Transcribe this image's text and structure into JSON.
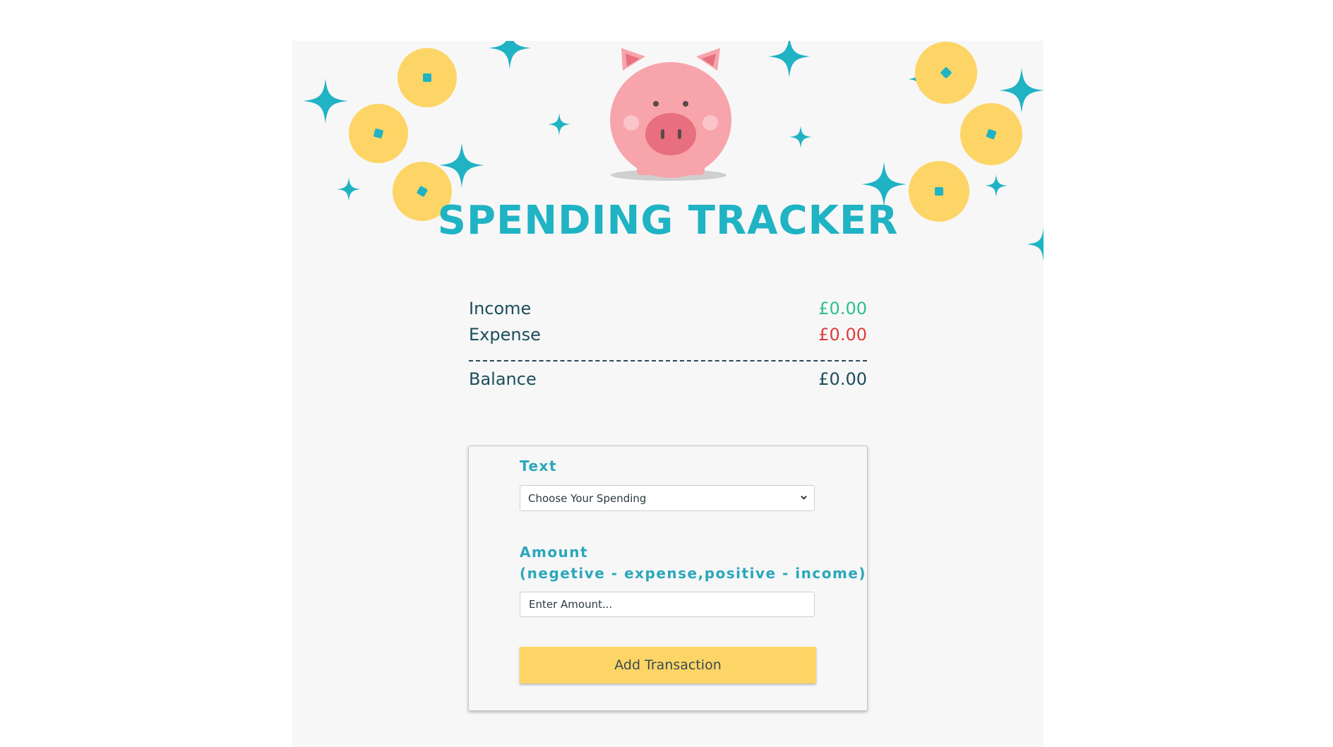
{
  "header": {
    "title": "SPENDING TRACKER",
    "illustration": "piggy-bank-with-coins-and-sparkles"
  },
  "summary": {
    "income": {
      "label": "Income",
      "value": "£0.00"
    },
    "expense": {
      "label": "Expense",
      "value": "£0.00"
    },
    "balance": {
      "label": "Balance",
      "value": "£0.00"
    }
  },
  "form": {
    "text_label": "Text",
    "select_value": "Choose Your Spending",
    "amount_label": "Amount",
    "amount_hint": "(negetive - expense,positive - income)",
    "amount_placeholder": "Enter Amount...",
    "submit_label": "Add Transaction"
  },
  "colors": {
    "accent": "#1fb3c4",
    "income": "#2ebf8a",
    "expense": "#e03a3a",
    "button": "#fdd566",
    "coin": "#fdd566",
    "pig": "#f7a4ab",
    "background": "#f7f7f7"
  }
}
